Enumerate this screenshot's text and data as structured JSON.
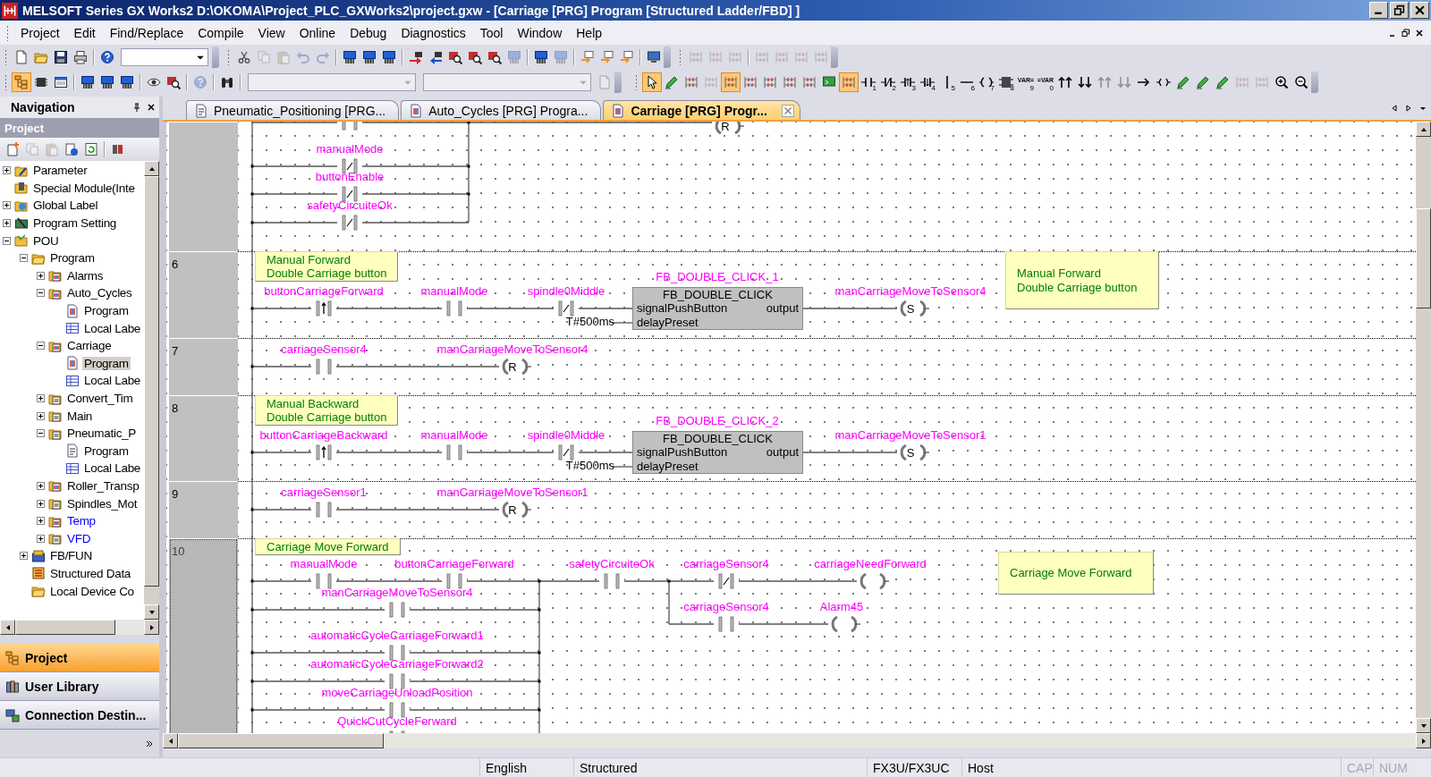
{
  "window": {
    "title": "MELSOFT Series GX Works2 D:\\OKOMA\\Project_PLC_GXWorks2\\project.gxw - [Carriage [PRG] Program [Structured Ladder/FBD] ]"
  },
  "menu": [
    "Project",
    "Edit",
    "Find/Replace",
    "Compile",
    "View",
    "Online",
    "Debug",
    "Diagnostics",
    "Tool",
    "Window",
    "Help"
  ],
  "toolbar_1": [
    {
      "disabled": false
    },
    {
      "disabled": false
    },
    {
      "disabled": false
    },
    {
      "disabled": false
    },
    {
      "disabled": false
    },
    {
      "disabled": false
    },
    {
      "disabled": true
    },
    {
      "disabled": true
    },
    {
      "disabled": true
    },
    {
      "disabled": true
    },
    {
      "disabled": false
    },
    {
      "disabled": false
    },
    {
      "disabled": false
    },
    {
      "disabled": false
    },
    {
      "disabled": false
    },
    {
      "disabled": false
    },
    {
      "disabled": false
    },
    {
      "disabled": false
    },
    {
      "disabled": true
    },
    {
      "disabled": false
    },
    {
      "disabled": true
    },
    {
      "disabled": false
    },
    {
      "disabled": false
    },
    {
      "disabled": false
    },
    {
      "disabled": false
    },
    {
      "disabled": true
    },
    {
      "disabled": true
    },
    {
      "disabled": true
    },
    {
      "disabled": true
    },
    {
      "disabled": true
    },
    {
      "disabled": true
    },
    {
      "disabled": true
    }
  ],
  "toolbar_2": [
    {
      "on": true,
      "disabled": false
    },
    {
      "on": false,
      "disabled": false
    },
    {
      "on": false,
      "disabled": false
    },
    {
      "on": false,
      "disabled": false
    },
    {
      "on": false,
      "disabled": false
    },
    {
      "on": false,
      "disabled": false
    },
    {
      "on": false,
      "disabled": false
    },
    {
      "on": false,
      "disabled": false
    },
    {
      "on": false,
      "disabled": true
    },
    {
      "on": false,
      "disabled": false
    },
    {
      "on": false,
      "disabled": true
    }
  ],
  "ladder_toolbar": [
    {
      "on": true,
      "disabled": false
    },
    {
      "on": false,
      "disabled": false
    },
    {
      "on": false,
      "disabled": false
    },
    {
      "on": false,
      "disabled": true
    },
    {
      "on": true,
      "disabled": false
    },
    {
      "on": false,
      "disabled": false
    },
    {
      "on": false,
      "disabled": false
    },
    {
      "on": false,
      "disabled": false
    },
    {
      "on": false,
      "disabled": false
    },
    {
      "on": false,
      "disabled": false
    },
    {
      "on": true,
      "disabled": false
    },
    {
      "on": false,
      "disabled": false,
      "key": "1"
    },
    {
      "on": false,
      "disabled": false,
      "key": "2"
    },
    {
      "on": false,
      "disabled": false,
      "key": "3"
    },
    {
      "on": false,
      "disabled": false,
      "key": "4"
    },
    {
      "on": false,
      "disabled": false,
      "key": "5"
    },
    {
      "on": false,
      "disabled": false,
      "key": "6"
    },
    {
      "on": false,
      "disabled": false,
      "key": "7"
    },
    {
      "on": false,
      "disabled": false,
      "key": "8"
    },
    {
      "on": false,
      "disabled": false,
      "label": "VAR=",
      "key": "9"
    },
    {
      "on": false,
      "disabled": false,
      "label": "=VAR",
      "key": "0"
    },
    {
      "on": false,
      "disabled": false
    },
    {
      "on": false,
      "disabled": false
    },
    {
      "on": false,
      "disabled": true
    },
    {
      "on": false,
      "disabled": true
    },
    {
      "on": false,
      "disabled": false
    },
    {
      "on": false,
      "disabled": false
    },
    {
      "on": false,
      "disabled": false
    },
    {
      "on": false,
      "disabled": false
    },
    {
      "on": false,
      "disabled": false
    },
    {
      "on": false,
      "disabled": true
    },
    {
      "on": false,
      "disabled": true
    },
    {
      "on": false,
      "disabled": false
    },
    {
      "on": false,
      "disabled": false
    }
  ],
  "navigation": {
    "title": "Navigation",
    "panel": "Project",
    "toolbar": [
      {
        "disabled": false
      },
      {
        "disabled": true
      },
      {
        "disabled": true
      },
      {
        "disabled": false
      },
      {
        "disabled": false
      },
      {
        "disabled": false
      }
    ],
    "tree": [
      {
        "label": "Parameter",
        "kind": "parameter",
        "expanded": false,
        "selected": false,
        "color": "#000000"
      },
      {
        "label": "Special Module(Inte",
        "kind": "module",
        "selected": false,
        "color": "#000000"
      },
      {
        "label": "Global Label",
        "kind": "global_label",
        "expanded": false,
        "selected": false,
        "color": "#000000"
      },
      {
        "label": "Program Setting",
        "kind": "setting",
        "expanded": false,
        "selected": false,
        "color": "#000000"
      },
      {
        "label": "POU",
        "kind": "pou",
        "expanded": true,
        "selected": false,
        "color": "#000000",
        "children": [
          {
            "label": "Program",
            "kind": "program_folder",
            "expanded": true,
            "selected": false,
            "color": "#000000",
            "children": [
              {
                "label": "Alarms",
                "kind": "ladder_pou",
                "expanded": false,
                "selected": false,
                "color": "#000000"
              },
              {
                "label": "Auto_Cycles",
                "kind": "ladder_pou",
                "expanded": true,
                "selected": false,
                "color": "#000000",
                "children": [
                  {
                    "label": "Program",
                    "kind": "ladder_program",
                    "selected": false,
                    "color": "#000000"
                  },
                  {
                    "label": "Local Labe",
                    "kind": "local_label",
                    "selected": false,
                    "color": "#000000"
                  }
                ]
              },
              {
                "label": "Carriage",
                "kind": "ladder_pou",
                "expanded": true,
                "selected": false,
                "color": "#000000",
                "children": [
                  {
                    "label": "Program",
                    "kind": "ladder_program",
                    "selected": true,
                    "color": "#000000"
                  },
                  {
                    "label": "Local Labe",
                    "kind": "local_label",
                    "selected": false,
                    "color": "#000000"
                  }
                ]
              },
              {
                "label": "Convert_Tim",
                "kind": "st_pou",
                "expanded": false,
                "selected": false,
                "color": "#000000"
              },
              {
                "label": "Main",
                "kind": "st_pou",
                "expanded": false,
                "selected": false,
                "color": "#000000"
              },
              {
                "label": "Pneumatic_P",
                "kind": "st_pou",
                "expanded": true,
                "selected": false,
                "color": "#000000",
                "children": [
                  {
                    "label": "Program",
                    "kind": "st_program",
                    "selected": false,
                    "color": "#000000"
                  },
                  {
                    "label": "Local Labe",
                    "kind": "local_label",
                    "selected": false,
                    "color": "#000000"
                  }
                ]
              },
              {
                "label": "Roller_Transp",
                "kind": "ladder_pou",
                "expanded": false,
                "selected": false,
                "color": "#000000"
              },
              {
                "label": "Spindles_Mot",
                "kind": "st_pou",
                "expanded": false,
                "selected": false,
                "color": "#000000"
              },
              {
                "label": "Temp",
                "kind": "ladder_pou",
                "expanded": false,
                "selected": false,
                "color": "#0000ff"
              },
              {
                "label": "VFD",
                "kind": "st_pou",
                "expanded": false,
                "selected": false,
                "color": "#0000ff"
              }
            ]
          },
          {
            "label": "FB/FUN",
            "kind": "fb_fun",
            "expanded": false,
            "selected": false,
            "color": "#000000"
          },
          {
            "label": "Structured Data",
            "kind": "structured_data",
            "selected": false,
            "color": "#000000"
          },
          {
            "label": "Local Device Co",
            "kind": "program_folder",
            "selected": false,
            "color": "#000000"
          }
        ]
      }
    ],
    "buttons": [
      {
        "label": "Project",
        "kind": "project",
        "selected": true
      },
      {
        "label": "User Library",
        "kind": "library",
        "selected": false
      },
      {
        "label": "Connection Destin...",
        "kind": "connection",
        "selected": false
      }
    ]
  },
  "tabs": [
    {
      "label": "Pneumatic_Positioning [PRG...",
      "kind": "st",
      "selected": false
    },
    {
      "label": "Auto_Cycles [PRG] Progra...",
      "kind": "ladder",
      "selected": false
    },
    {
      "label": "Carriage [PRG] Progr...",
      "kind": "ladder",
      "selected": true
    }
  ],
  "rungs": [
    {
      "selected": false,
      "elements": [
        {
          "kind": "contact_no"
        },
        {
          "kind": "contact_nc",
          "label": "manualMode"
        },
        {
          "kind": "contact_nc",
          "label": "buttonEnable"
        },
        {
          "kind": "contact_nc",
          "label": "safetyCircuiteOk"
        },
        {
          "kind": "coil",
          "letter": "R"
        }
      ]
    },
    {
      "number": "6",
      "selected": false,
      "comment": "Manual Forward\nDouble Carriage button",
      "note": "Manual Forward\nDouble Carriage button",
      "elements": [
        {
          "kind": "contact_rising",
          "label": "buttonCarriageForward"
        },
        {
          "kind": "contact_no",
          "label": "manualMode"
        },
        {
          "kind": "contact_nc",
          "label": "spindle0Middle"
        },
        {
          "kind": "constant",
          "text": "T#500ms"
        },
        {
          "kind": "fb",
          "instance": "FB_DOUBLE_CLICK_1",
          "type_name": "FB_DOUBLE_CLICK",
          "inputs": [
            "signalPushButton",
            "delayPreset"
          ],
          "outputs": [
            "output"
          ]
        },
        {
          "kind": "coil",
          "letter": "S",
          "label": "manCarriageMoveToSensor4"
        }
      ]
    },
    {
      "number": "7",
      "selected": false,
      "elements": [
        {
          "kind": "contact_no",
          "label": "carriageSensor4"
        },
        {
          "kind": "coil",
          "letter": "R",
          "label": "manCarriageMoveToSensor4"
        }
      ]
    },
    {
      "number": "8",
      "selected": false,
      "comment": "Manual Backward\nDouble Carriage button",
      "elements": [
        {
          "kind": "contact_rising",
          "label": "buttonCarriageBackward"
        },
        {
          "kind": "contact_no",
          "label": "manualMode"
        },
        {
          "kind": "contact_nc",
          "label": "spindle0Middle"
        },
        {
          "kind": "constant",
          "text": "T#500ms"
        },
        {
          "kind": "fb",
          "instance": "FB_DOUBLE_CLICK_2",
          "type_name": "FB_DOUBLE_CLICK",
          "inputs": [
            "signalPushButton",
            "delayPreset"
          ],
          "outputs": [
            "output"
          ]
        },
        {
          "kind": "coil",
          "letter": "S",
          "label": "manCarriageMoveToSensor1"
        }
      ]
    },
    {
      "number": "9",
      "selected": false,
      "elements": [
        {
          "kind": "contact_no",
          "label": "carriageSensor1"
        },
        {
          "kind": "coil",
          "letter": "R",
          "label": "manCarriageMoveToSensor1"
        }
      ]
    },
    {
      "number": "10",
      "selected": true,
      "comment": "Carriage Move Forward",
      "note": "Carriage Move Forward",
      "elements": [
        {
          "kind": "contact_no",
          "label": "manualMode"
        },
        {
          "kind": "contact_no",
          "label": "buttonCarriageForward"
        },
        {
          "kind": "contact_no",
          "label": "manCarriageMoveToSensor4"
        },
        {
          "kind": "contact_no",
          "label": "automaticCycleCarriageForward1"
        },
        {
          "kind": "contact_no",
          "label": "automaticCycleCarriageForward2"
        },
        {
          "kind": "contact_no",
          "label": "moveCarriageUnloadPosition"
        },
        {
          "kind": "contact_no",
          "label": "QuickCutCycleForward"
        },
        {
          "kind": "contact_no",
          "label": "safetyCircuiteOk"
        },
        {
          "kind": "contact_nc",
          "label": "carriageSensor4"
        },
        {
          "kind": "coil",
          "label": "carriageNeedForward"
        },
        {
          "kind": "contact_no",
          "label": "carriageSensor4"
        },
        {
          "kind": "coil",
          "label": "Alarm45"
        }
      ]
    }
  ],
  "status_bar": [
    {
      "text": "English",
      "disabled": false
    },
    {
      "text": "Structured",
      "disabled": false
    },
    {
      "text": "FX3U/FX3UC",
      "disabled": false
    },
    {
      "text": "Host",
      "disabled": false
    },
    {
      "text": "CAP",
      "disabled": true
    },
    {
      "text": "NUM",
      "disabled": true
    }
  ]
}
